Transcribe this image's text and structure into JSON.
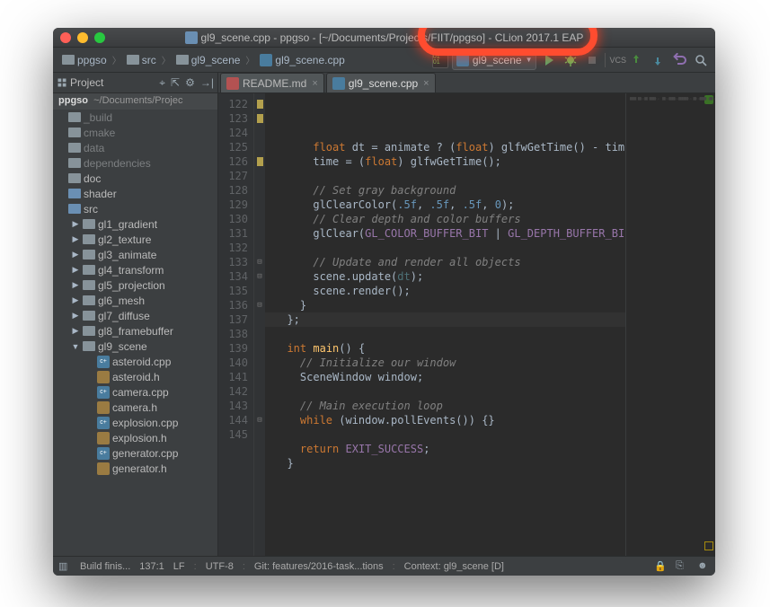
{
  "window": {
    "title": "gl9_scene.cpp - ppgso - [~/Documents/Projects/FIIT/ppgso] - CLion 2017.1 EAP"
  },
  "breadcrumbs": {
    "items": [
      {
        "label": "ppgso",
        "icon": "folder"
      },
      {
        "label": "src",
        "icon": "folder"
      },
      {
        "label": "gl9_scene",
        "icon": "folder"
      },
      {
        "label": "gl9_scene.cpp",
        "icon": "cpp"
      }
    ]
  },
  "run": {
    "build_badge": "01\n01",
    "config_label": "gl9_scene"
  },
  "toolbar": {
    "vcs_label": "VCS"
  },
  "sidebar": {
    "header": "Project",
    "root_name": "ppgso",
    "root_path": "~/Documents/Projec",
    "tree": [
      {
        "label": "_build",
        "icon": "folder",
        "dim": true,
        "indent": 0,
        "arrow": ""
      },
      {
        "label": "cmake",
        "icon": "folder",
        "dim": true,
        "indent": 0,
        "arrow": ""
      },
      {
        "label": "data",
        "icon": "folder",
        "dim": true,
        "indent": 0,
        "arrow": ""
      },
      {
        "label": "dependencies",
        "icon": "folder",
        "dim": true,
        "indent": 0,
        "arrow": ""
      },
      {
        "label": "doc",
        "icon": "folder",
        "dim": false,
        "indent": 0,
        "arrow": ""
      },
      {
        "label": "shader",
        "icon": "folder-mod",
        "dim": false,
        "indent": 0,
        "arrow": ""
      },
      {
        "label": "src",
        "icon": "folder-mod",
        "dim": false,
        "indent": 0,
        "arrow": ""
      },
      {
        "label": "gl1_gradient",
        "icon": "folder",
        "dim": false,
        "indent": 1,
        "arrow": "▶"
      },
      {
        "label": "gl2_texture",
        "icon": "folder",
        "dim": false,
        "indent": 1,
        "arrow": "▶"
      },
      {
        "label": "gl3_animate",
        "icon": "folder",
        "dim": false,
        "indent": 1,
        "arrow": "▶"
      },
      {
        "label": "gl4_transform",
        "icon": "folder",
        "dim": false,
        "indent": 1,
        "arrow": "▶"
      },
      {
        "label": "gl5_projection",
        "icon": "folder",
        "dim": false,
        "indent": 1,
        "arrow": "▶"
      },
      {
        "label": "gl6_mesh",
        "icon": "folder",
        "dim": false,
        "indent": 1,
        "arrow": "▶"
      },
      {
        "label": "gl7_diffuse",
        "icon": "folder",
        "dim": false,
        "indent": 1,
        "arrow": "▶"
      },
      {
        "label": "gl8_framebuffer",
        "icon": "folder",
        "dim": false,
        "indent": 1,
        "arrow": "▶"
      },
      {
        "label": "gl9_scene",
        "icon": "folder",
        "dim": false,
        "indent": 1,
        "arrow": "▼"
      },
      {
        "label": "asteroid.cpp",
        "icon": "cpp",
        "indent": 2,
        "arrow": ""
      },
      {
        "label": "asteroid.h",
        "icon": "h",
        "indent": 2,
        "arrow": ""
      },
      {
        "label": "camera.cpp",
        "icon": "cpp",
        "indent": 2,
        "arrow": ""
      },
      {
        "label": "camera.h",
        "icon": "h",
        "indent": 2,
        "arrow": ""
      },
      {
        "label": "explosion.cpp",
        "icon": "cpp",
        "indent": 2,
        "arrow": ""
      },
      {
        "label": "explosion.h",
        "icon": "h",
        "indent": 2,
        "arrow": ""
      },
      {
        "label": "generator.cpp",
        "icon": "cpp",
        "indent": 2,
        "arrow": ""
      },
      {
        "label": "generator.h",
        "icon": "h",
        "indent": 2,
        "arrow": ""
      }
    ]
  },
  "tabs": [
    {
      "label": "README.md",
      "icon": "md",
      "active": false
    },
    {
      "label": "gl9_scene.cpp",
      "icon": "cp",
      "active": true
    }
  ],
  "editor": {
    "first_line": 122,
    "lines": [
      {
        "n": 122,
        "m": "y",
        "h": "      <span class=k>float</span> dt = animate ? (<span class=k>float</span>) glfwGetTime() - tim"
      },
      {
        "n": 123,
        "m": "y",
        "h": "      time = (<span class=k>float</span>) glfwGetTime();"
      },
      {
        "n": 124,
        "m": "",
        "h": ""
      },
      {
        "n": 125,
        "m": "",
        "h": "      <span class=c>// Set gray background</span>"
      },
      {
        "n": 126,
        "m": "y",
        "h": "      glClearColor(<span class=n>.5f</span>, <span class=n>.5f</span>, <span class=n>.5f</span>, <span class=n>0</span>);"
      },
      {
        "n": 127,
        "m": "",
        "h": "      <span class=c>// Clear depth and color buffers</span>"
      },
      {
        "n": 128,
        "m": "",
        "h": "      glClear(<span class=cn>GL_COLOR_BUFFER_BIT</span> | <span class=cn>GL_DEPTH_BUFFER_BI</span>"
      },
      {
        "n": 129,
        "m": "",
        "h": ""
      },
      {
        "n": 130,
        "m": "",
        "h": "      <span class=c>// Update and render all objects</span>"
      },
      {
        "n": 131,
        "m": "",
        "h": "      scene.update(<span style='color:#4d7177'>dt</span>);"
      },
      {
        "n": 132,
        "m": "",
        "h": "      scene.render();"
      },
      {
        "n": 133,
        "m": "f",
        "h": "    }"
      },
      {
        "n": 134,
        "m": "f",
        "h": "  };"
      },
      {
        "n": 135,
        "m": "",
        "h": ""
      },
      {
        "n": 136,
        "m": "f",
        "h": "  <span class=k>int</span> <span class=fnc>main</span>() {"
      },
      {
        "n": 137,
        "m": "",
        "h": "    <span class=c>// Initialize our window</span>"
      },
      {
        "n": 138,
        "m": "",
        "h": "    <span class=t>SceneWindow</span> window;"
      },
      {
        "n": 139,
        "m": "",
        "h": ""
      },
      {
        "n": 140,
        "m": "",
        "h": "    <span class=c>// Main execution loop</span>"
      },
      {
        "n": 141,
        "m": "",
        "h": "    <span class=k>while</span> (window.pollEvents()) {}"
      },
      {
        "n": 142,
        "m": "",
        "h": ""
      },
      {
        "n": 143,
        "m": "",
        "h": "    <span class=k>return</span> <span class=cn>EXIT_SUCCESS</span>;"
      },
      {
        "n": 144,
        "m": "f",
        "h": "  }"
      },
      {
        "n": 145,
        "m": "",
        "h": ""
      }
    ]
  },
  "status": {
    "build": "Build finis...",
    "pos": "137:1",
    "lf": "LF",
    "enc": "UTF-8",
    "git": "Git: features/2016-task...tions",
    "context": "Context: gl9_scene [D]"
  }
}
